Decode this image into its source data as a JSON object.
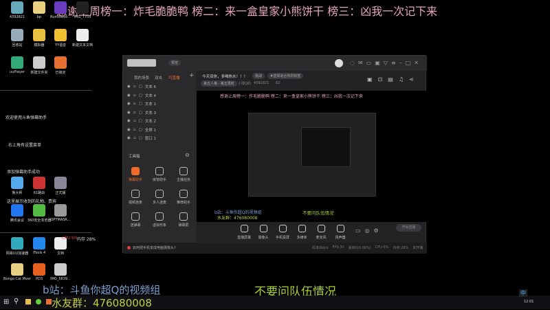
{
  "banner": "感谢上周榜一：炸毛脆脆鸭 榜二：来一盒皇家小熊饼干 榜三：凶我一次记下来",
  "desktop_icons": [
    "4392821",
    "bp",
    "Rumbleve...",
    "IMG_7705",
    "回收站",
    "模拟器",
    "YY语音",
    "新建文本文档",
    "uuPlayer",
    "新建文件夹",
    "已锁定",
    "鲁大师",
    "61路由",
    "正式版",
    "腾讯会议",
    "360安全浏览器",
    "OPTMASR...",
    "网易UU加速器",
    "iTools 4",
    "文档",
    "Bongo Cat Mver",
    "PD3",
    "IMG_5839..."
  ],
  "chat_lines": [
    "欢迎使用斗鱼弹幕助手",
    "右上角有设置菜单",
    "添加弹幕助手成功",
    "这里展示收到的礼物、贵宾"
  ],
  "perf": {
    "cpu": "CPU 6%",
    "mem": "内存 28%"
  },
  "app": {
    "live_badge": "预览",
    "tabs": [
      "我的场景",
      "双击",
      "可直播"
    ],
    "scenes": [
      "文本 6",
      "文本 4",
      "文本 1",
      "文本 3",
      "文本 2",
      "全屏 1",
      "窗口 1"
    ],
    "toolbox_title": "工具箱",
    "tools": [
      "弹幕助手",
      "房管助手",
      "主播任务",
      "视频连麦",
      "多人连麦",
      "推荐助手",
      "送弹幕",
      "虚拟形象",
      "弹幕屏"
    ],
    "room_title": "今天双休，多喝热水！！！",
    "edit_tag": "挑战",
    "tag_placeholder": "#选择适合你的标签",
    "category": "第五人格 · 第五限时",
    "room_label": "小球Q的",
    "room_id": "4392821",
    "hot": "62",
    "controls": [
      "直播屏幕",
      "摄像头",
      "手机投屏",
      "多媒体",
      "麦克风",
      "扬声器"
    ],
    "start_button": "开始直播",
    "tip": "如何把手机变成电脑摄像头?",
    "status": [
      "码率0kb/s",
      "FPS:30",
      "丢帧0(0.00%)",
      "CPU:6%",
      "内存:28%",
      "未开播"
    ]
  },
  "overlay": {
    "bilibili": "b站：斗鱼你超Q的视频组",
    "qq_group": "水友群：476080008",
    "notice": "不要问队伍情况"
  },
  "taskbar": {
    "time": "12:01",
    "ime": "中"
  },
  "colors": {
    "accent": "#f26b2a",
    "banner": "#e6a4bd",
    "notice": "#a8d030",
    "bilibili": "#7aa0d0",
    "qq": "#c0d040"
  }
}
